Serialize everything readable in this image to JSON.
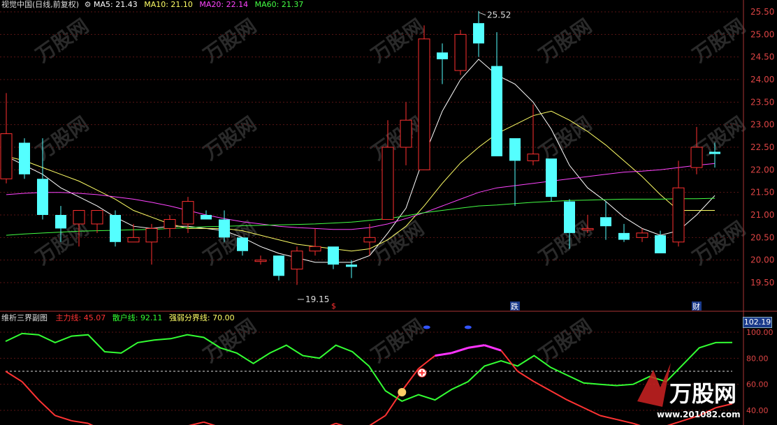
{
  "header": {
    "title": "视觉中国(日线,前复权)",
    "ma": [
      {
        "label": "MA5:",
        "value": "21.43",
        "color": "#ffffff"
      },
      {
        "label": "MA10:",
        "value": "21.10",
        "color": "#ffff66"
      },
      {
        "label": "MA20:",
        "value": "22.14",
        "color": "#ff44ff"
      },
      {
        "label": "MA60:",
        "value": "21.37",
        "color": "#44ff44"
      }
    ]
  },
  "indicator": {
    "title": "维析三界副图",
    "lines": [
      {
        "label": "主力线:",
        "value": "45.07",
        "color": "#ff3333"
      },
      {
        "label": "散户线:",
        "value": "92.11",
        "color": "#33ff33"
      },
      {
        "label": "强弱分界线:",
        "value": "70.00",
        "color": "#ffff66"
      }
    ],
    "box_value": "102.19"
  },
  "watermark": {
    "brand": "万股网",
    "url": "www.201082.com"
  },
  "chart_data": [
    {
      "type": "candlestick",
      "title": "视觉中国(日线,前复权)",
      "ylim": [
        19.15,
        25.8
      ],
      "yticks": [
        "25.50",
        "25.00",
        "24.50",
        "24.00",
        "23.50",
        "23.00",
        "22.50",
        "22.00",
        "21.50",
        "21.00",
        "20.50",
        "20.00",
        "19.50"
      ],
      "candles": [
        {
          "o": 21.8,
          "h": 23.7,
          "l": 21.7,
          "c": 22.8
        },
        {
          "o": 22.6,
          "h": 22.7,
          "l": 21.8,
          "c": 21.9
        },
        {
          "o": 21.8,
          "h": 22.7,
          "l": 20.9,
          "c": 21.0
        },
        {
          "o": 21.0,
          "h": 21.2,
          "l": 20.4,
          "c": 20.7
        },
        {
          "o": 20.8,
          "h": 21.1,
          "l": 20.3,
          "c": 21.1
        },
        {
          "o": 20.8,
          "h": 21.1,
          "l": 20.6,
          "c": 21.1
        },
        {
          "o": 21.0,
          "h": 21.1,
          "l": 20.3,
          "c": 20.4
        },
        {
          "o": 20.4,
          "h": 20.8,
          "l": 20.4,
          "c": 20.5
        },
        {
          "o": 20.4,
          "h": 20.8,
          "l": 19.9,
          "c": 20.7
        },
        {
          "o": 20.7,
          "h": 21.0,
          "l": 20.5,
          "c": 20.9
        },
        {
          "o": 20.8,
          "h": 21.4,
          "l": 20.6,
          "c": 21.3
        },
        {
          "o": 21.0,
          "h": 21.1,
          "l": 20.9,
          "c": 20.9
        },
        {
          "o": 20.9,
          "h": 21.1,
          "l": 20.4,
          "c": 20.5
        },
        {
          "o": 20.5,
          "h": 20.5,
          "l": 20.1,
          "c": 20.2
        },
        {
          "o": 20.0,
          "h": 20.1,
          "l": 19.9,
          "c": 20.0
        },
        {
          "o": 20.1,
          "h": 20.1,
          "l": 19.55,
          "c": 19.65
        },
        {
          "o": 19.8,
          "h": 20.3,
          "l": 19.45,
          "c": 20.2
        },
        {
          "o": 20.2,
          "h": 20.7,
          "l": 20.1,
          "c": 20.3
        },
        {
          "o": 20.3,
          "h": 20.3,
          "l": 19.8,
          "c": 19.9
        },
        {
          "o": 19.9,
          "h": 20.0,
          "l": 19.6,
          "c": 19.85
        },
        {
          "o": 20.4,
          "h": 20.8,
          "l": 20.1,
          "c": 20.5
        },
        {
          "o": 20.9,
          "h": 23.1,
          "l": 20.9,
          "c": 22.5
        },
        {
          "o": 22.5,
          "h": 23.5,
          "l": 22.1,
          "c": 23.1
        },
        {
          "o": 22.0,
          "h": 25.2,
          "l": 22.0,
          "c": 24.9
        },
        {
          "o": 24.6,
          "h": 24.8,
          "l": 23.9,
          "c": 24.45
        },
        {
          "o": 24.2,
          "h": 25.1,
          "l": 24.1,
          "c": 25.0
        },
        {
          "o": 25.25,
          "h": 25.52,
          "l": 24.5,
          "c": 24.8
        },
        {
          "o": 24.3,
          "h": 25.05,
          "l": 22.3,
          "c": 22.3
        },
        {
          "o": 22.7,
          "h": 22.7,
          "l": 21.2,
          "c": 22.2
        },
        {
          "o": 22.2,
          "h": 23.45,
          "l": 22.1,
          "c": 22.35
        },
        {
          "o": 22.25,
          "h": 22.25,
          "l": 21.3,
          "c": 21.4
        },
        {
          "o": 21.3,
          "h": 21.35,
          "l": 20.25,
          "c": 20.6
        },
        {
          "o": 20.7,
          "h": 21.0,
          "l": 20.6,
          "c": 20.7
        },
        {
          "o": 20.95,
          "h": 21.3,
          "l": 20.45,
          "c": 20.75
        },
        {
          "o": 20.6,
          "h": 20.8,
          "l": 20.4,
          "c": 20.45
        },
        {
          "o": 20.5,
          "h": 20.7,
          "l": 20.4,
          "c": 20.6
        },
        {
          "o": 20.55,
          "h": 20.65,
          "l": 20.15,
          "c": 20.15
        },
        {
          "o": 20.4,
          "h": 22.2,
          "l": 20.3,
          "c": 21.6
        },
        {
          "o": 22.05,
          "h": 22.95,
          "l": 21.9,
          "c": 22.5
        },
        {
          "o": 22.4,
          "h": 22.6,
          "l": 22.05,
          "c": 22.35
        }
      ],
      "series": [
        {
          "name": "MA5",
          "color": "#ffffff",
          "values": [
            22.3,
            22.1,
            21.9,
            21.6,
            21.4,
            21.2,
            20.95,
            20.75,
            20.7,
            20.75,
            20.75,
            20.7,
            20.65,
            20.5,
            20.3,
            20.15,
            20.05,
            19.95,
            19.95,
            19.95,
            20.1,
            20.6,
            21.15,
            22.3,
            23.3,
            24.0,
            24.45,
            24.1,
            23.9,
            23.5,
            22.9,
            22.1,
            21.6,
            21.3,
            20.95,
            20.7,
            20.55,
            20.65,
            21.0,
            21.43
          ]
        },
        {
          "name": "MA10",
          "color": "#ffff66",
          "values": [
            22.3,
            22.2,
            22.05,
            21.9,
            21.75,
            21.55,
            21.35,
            21.1,
            20.95,
            20.8,
            20.7,
            20.7,
            20.7,
            20.65,
            20.55,
            20.45,
            20.35,
            20.3,
            20.25,
            20.2,
            20.25,
            20.45,
            20.75,
            21.2,
            21.7,
            22.15,
            22.5,
            22.8,
            23.0,
            23.2,
            23.3,
            23.1,
            22.85,
            22.55,
            22.2,
            21.85,
            21.45,
            21.1,
            21.1,
            21.1
          ]
        },
        {
          "name": "MA20",
          "color": "#ff44ff",
          "values": [
            21.45,
            21.48,
            21.5,
            21.5,
            21.48,
            21.45,
            21.4,
            21.35,
            21.28,
            21.2,
            21.1,
            21.0,
            20.92,
            20.85,
            20.8,
            20.75,
            20.72,
            20.7,
            20.68,
            20.68,
            20.72,
            20.8,
            20.92,
            21.05,
            21.2,
            21.35,
            21.5,
            21.6,
            21.65,
            21.7,
            21.75,
            21.8,
            21.85,
            21.9,
            21.95,
            21.97,
            22.0,
            22.05,
            22.1,
            22.14
          ]
        },
        {
          "name": "MA60",
          "color": "#44ff44",
          "values": [
            20.55,
            20.58,
            20.6,
            20.62,
            20.64,
            20.65,
            20.66,
            20.67,
            20.68,
            20.7,
            20.72,
            20.74,
            20.75,
            20.76,
            20.77,
            20.78,
            20.79,
            20.8,
            20.82,
            20.84,
            20.88,
            20.92,
            20.98,
            21.05,
            21.1,
            21.15,
            21.2,
            21.22,
            21.25,
            21.28,
            21.3,
            21.32,
            21.33,
            21.34,
            21.35,
            21.35,
            21.35,
            21.36,
            21.36,
            21.37
          ]
        }
      ],
      "annotations": [
        {
          "text": "25.52",
          "index": 26,
          "price": 25.52
        },
        {
          "text": "19.15",
          "index": 16,
          "price": 19.45
        },
        {
          "text": "$",
          "index": 18,
          "kind": "marker"
        },
        {
          "text": "跌",
          "index": 28,
          "kind": "badge"
        },
        {
          "text": "财",
          "index": 38,
          "kind": "badge"
        }
      ]
    },
    {
      "type": "line",
      "title": "维析三界副图",
      "ylim": [
        18,
        105
      ],
      "yticks": [
        "100.00",
        "80.00",
        "60.00",
        "40.00"
      ],
      "series": [
        {
          "name": "主力线",
          "color": "#ff3333",
          "values": [
            70,
            62,
            48,
            36,
            32,
            30,
            24,
            22,
            24,
            26,
            27,
            28,
            31,
            27,
            22,
            20,
            18,
            18,
            20,
            25,
            30,
            26,
            28,
            36,
            55,
            72,
            82,
            84,
            88,
            90,
            86,
            70,
            62,
            55,
            48,
            42,
            36,
            33,
            30,
            26,
            28,
            32,
            36,
            42,
            45.07
          ]
        },
        {
          "name": "散户线",
          "color": "#33ff33",
          "values": [
            93,
            99,
            98,
            92,
            97,
            98,
            85,
            84,
            92,
            94,
            95,
            98,
            96,
            88,
            84,
            76,
            84,
            90,
            82,
            80,
            90,
            85,
            74,
            55,
            47,
            52,
            48,
            56,
            62,
            74,
            78,
            74,
            82,
            73,
            67,
            61,
            60,
            59,
            60,
            66,
            62,
            75,
            88,
            92,
            92.11
          ]
        },
        {
          "name": "强弱分界线",
          "color": "#ffff66",
          "values": [
            70,
            70,
            70,
            70,
            70,
            70,
            70,
            70,
            70,
            70,
            70,
            70,
            70,
            70,
            70,
            70,
            70,
            70,
            70,
            70,
            70,
            70,
            70,
            70,
            70,
            70,
            70,
            70,
            70,
            70,
            70,
            70,
            70,
            70,
            70,
            70,
            70,
            70,
            70,
            70,
            70,
            70,
            70,
            70,
            70
          ]
        }
      ]
    }
  ]
}
